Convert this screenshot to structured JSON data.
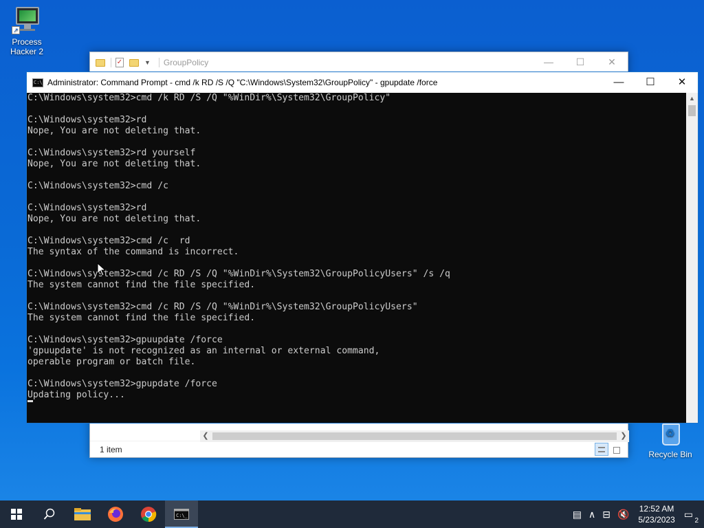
{
  "desktop": {
    "icons": [
      {
        "label": "Process Hacker 2"
      },
      {
        "label": "Recycle Bin"
      }
    ]
  },
  "explorer": {
    "title": "GroupPolicy",
    "status": "1 item",
    "controls": {
      "minimize": "—",
      "maximize": "☐",
      "close": "✕"
    }
  },
  "cmd": {
    "title": "Administrator:  Command Prompt - cmd  /k RD /S /Q \"C:\\Windows\\System32\\GroupPolicy\" - gpupdate  /force",
    "icon_text": "C:\\_",
    "controls": {
      "minimize": "—",
      "maximize": "☐",
      "close": "✕"
    },
    "lines": [
      "C:\\Windows\\system32>cmd /k RD /S /Q \"%WinDir%\\System32\\GroupPolicy\"",
      "",
      "C:\\Windows\\system32>rd",
      "Nope, You are not deleting that.",
      "",
      "C:\\Windows\\system32>rd yourself",
      "Nope, You are not deleting that.",
      "",
      "C:\\Windows\\system32>cmd /c",
      "",
      "C:\\Windows\\system32>rd",
      "Nope, You are not deleting that.",
      "",
      "C:\\Windows\\system32>cmd /c  rd",
      "The syntax of the command is incorrect.",
      "",
      "C:\\Windows\\system32>cmd /c RD /S /Q \"%WinDir%\\System32\\GroupPolicyUsers\" /s /q",
      "The system cannot find the file specified.",
      "",
      "C:\\Windows\\system32>cmd /c RD /S /Q \"%WinDir%\\System32\\GroupPolicyUsers\"",
      "The system cannot find the file specified.",
      "",
      "C:\\Windows\\system32>gpuupdate /force",
      "'gpuupdate' is not recognized as an internal or external command,",
      "operable program or batch file.",
      "",
      "C:\\Windows\\system32>gpupdate /force",
      "Updating policy..."
    ]
  },
  "taskbar": {
    "items": [
      {
        "name": "start-button",
        "icon": "windows-logo-icon"
      },
      {
        "name": "search-button",
        "icon": "search-icon"
      },
      {
        "name": "file-explorer",
        "icon": "folder-icon"
      },
      {
        "name": "firefox",
        "icon": "firefox-icon"
      },
      {
        "name": "chrome",
        "icon": "chrome-icon"
      },
      {
        "name": "command-prompt",
        "icon": "terminal-icon",
        "active": true
      }
    ],
    "time": "12:52 AM",
    "date": "5/23/2023",
    "notification_count": "2"
  },
  "colors": {
    "console_bg": "#0c0c0c",
    "console_text": "#cccccc",
    "taskbar_bg": "#1f2a3a",
    "accent": "#1c73c9"
  }
}
